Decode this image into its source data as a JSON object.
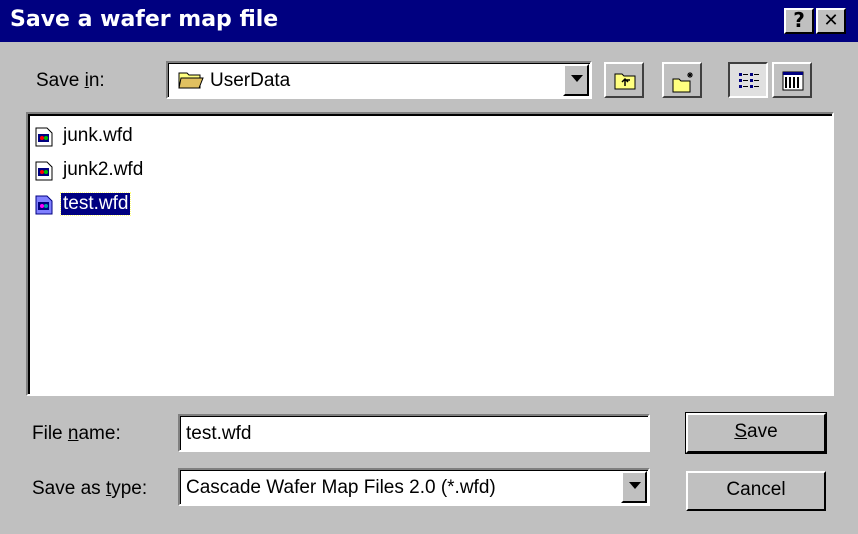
{
  "window": {
    "title": "Save a wafer map file",
    "help_label": "?",
    "close_label": "✕"
  },
  "save_in": {
    "label_prefix": "Save ",
    "label_access": "i",
    "label_suffix": "n:",
    "value": "UserData"
  },
  "toolbar": {
    "up_one_level": "up-folder-icon",
    "new_folder": "new-folder-icon",
    "list_view": "list-view-icon",
    "details_view": "details-view-icon"
  },
  "files": [
    {
      "name": "junk.wfd",
      "selected": false
    },
    {
      "name": "junk2.wfd",
      "selected": false
    },
    {
      "name": "test.wfd",
      "selected": true
    }
  ],
  "file_name": {
    "label_prefix": "File ",
    "label_access": "n",
    "label_suffix": "ame:",
    "value": "test.wfd"
  },
  "save_as_type": {
    "label_prefix": "Save as ",
    "label_access": "t",
    "label_suffix": "ype:",
    "value": "Cascade Wafer Map Files 2.0 (*.wfd)"
  },
  "buttons": {
    "save_access": "S",
    "save_rest": "ave",
    "cancel": "Cancel"
  },
  "colors": {
    "titlebar": "#000080",
    "face": "#c0c0c0",
    "selection": "#000080"
  }
}
